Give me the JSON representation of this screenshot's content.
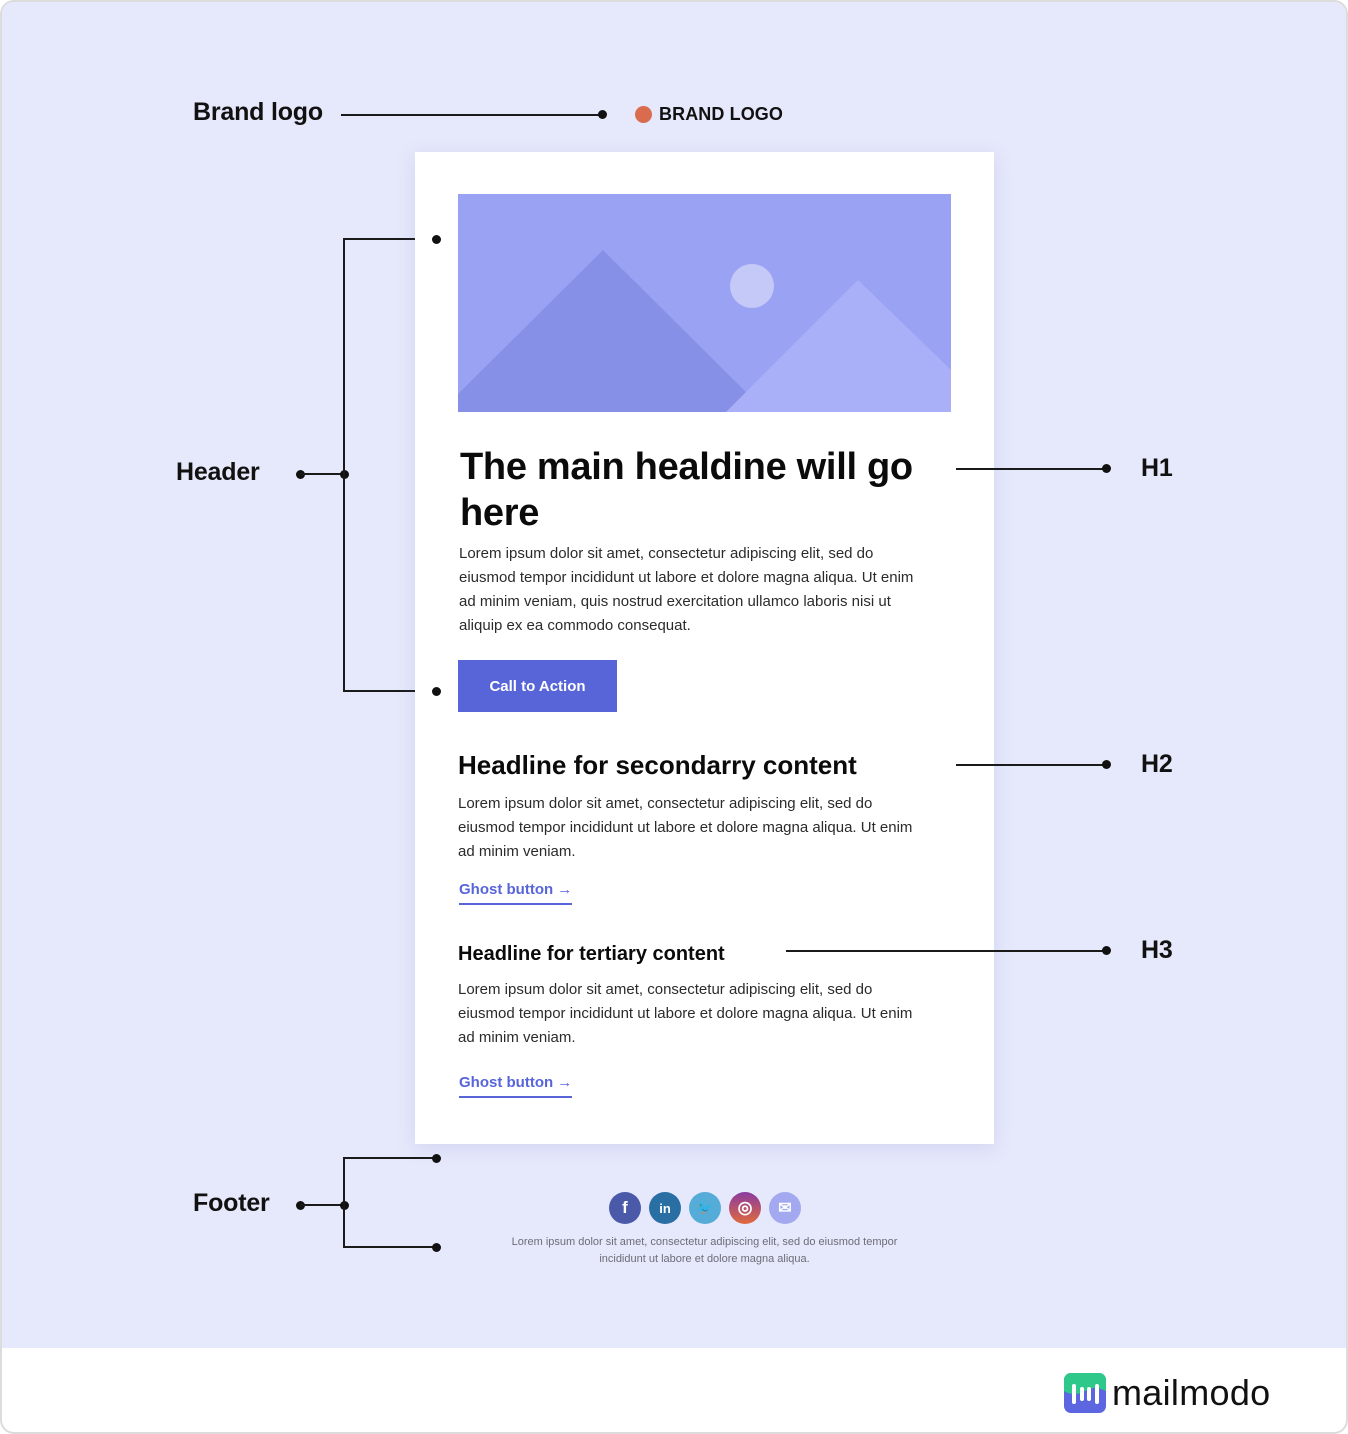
{
  "annotations": {
    "brand_logo": "Brand logo",
    "header": "Header",
    "h1": "H1",
    "h2": "H2",
    "h3": "H3",
    "footer": "Footer"
  },
  "email": {
    "brand": {
      "text": "BRAND LOGO",
      "dot_color": "#d96b4f"
    },
    "hero_image": {
      "icon": "image-placeholder-icon",
      "colors": {
        "sky": "#9aa2f3",
        "mountain_left": "#8690e6",
        "mountain_right": "#aab0f8",
        "sun": "#c5c9f7"
      }
    },
    "h1": "The main healdine will go here",
    "h1_body": "Lorem ipsum dolor sit amet, consectetur adipiscing elit, sed do eiusmod tempor incididunt ut labore et dolore magna aliqua. Ut enim ad minim veniam, quis nostrud exercitation ullamco laboris nisi ut aliquip ex ea commodo consequat.",
    "cta_label": "Call to Action",
    "h2": "Headline for secondarry content",
    "h2_body": "Lorem ipsum dolor sit amet, consectetur adipiscing elit, sed do eiusmod tempor incididunt ut labore et dolore magna aliqua. Ut enim ad minim veniam.",
    "ghost_button_1": "Ghost button →",
    "h3": "Headline for tertiary content",
    "h3_body": "Lorem ipsum dolor sit amet, consectetur adipiscing elit, sed do eiusmod tempor incididunt ut labore et dolore magna aliqua. Ut enim ad minim veniam.",
    "ghost_button_2": "Ghost button →",
    "accent_color": "#5865d9"
  },
  "footer": {
    "socials": [
      {
        "name": "facebook",
        "icon": "facebook-icon",
        "glyph": "f",
        "color": "#4a5aa8"
      },
      {
        "name": "linkedin",
        "icon": "linkedin-icon",
        "glyph": "in",
        "color": "#2a6fa3"
      },
      {
        "name": "twitter",
        "icon": "twitter-icon",
        "glyph": "🐦",
        "color": "#55acd8"
      },
      {
        "name": "instagram",
        "icon": "instagram-icon",
        "glyph": "◎",
        "color": "#a6417a"
      },
      {
        "name": "email",
        "icon": "mail-icon",
        "glyph": "✉",
        "color": "#a3a9f0"
      }
    ],
    "text": "Lorem ipsum dolor sit amet, consectetur adipiscing elit, sed do eiusmod tempor incididunt ut labore et dolore magna aliqua."
  },
  "watermark": {
    "brand": "mailmodo"
  }
}
